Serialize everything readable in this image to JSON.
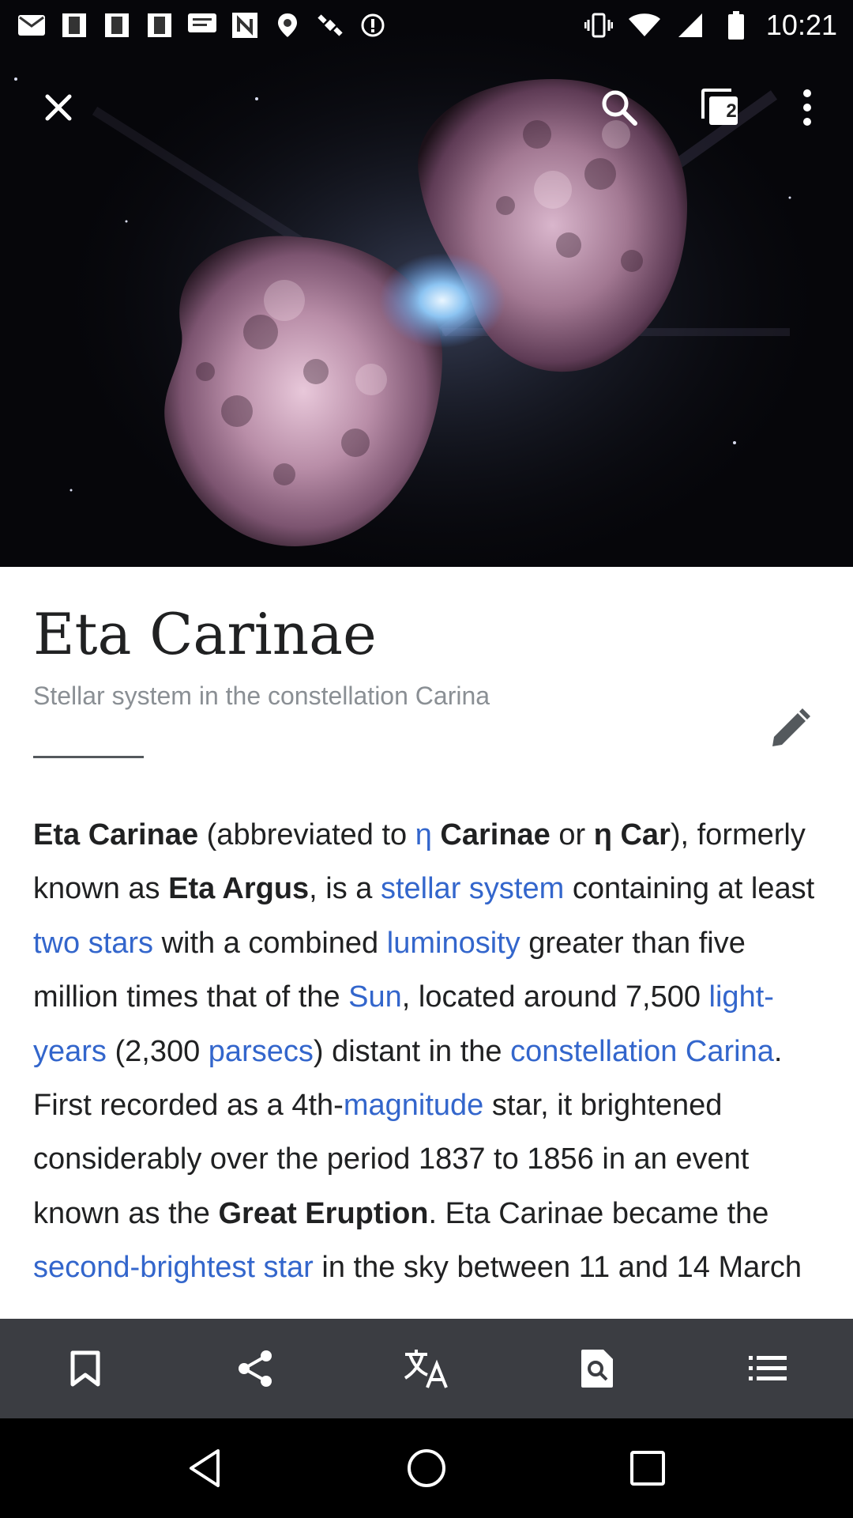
{
  "status_bar": {
    "time": "10:21",
    "left_icons": [
      "mail-icon",
      "photo-icon",
      "photo-icon",
      "photo-icon",
      "message-icon",
      "news-icon",
      "fake-gps-icon",
      "satellite-icon",
      "alert-icon"
    ],
    "right_icons": [
      "vibrate-icon",
      "wifi-icon",
      "signal-icon",
      "battery-icon"
    ]
  },
  "header": {
    "tabs_count": "2",
    "icons": [
      "close-icon",
      "search-icon",
      "tabs-icon",
      "overflow-menu-icon"
    ]
  },
  "article": {
    "title": "Eta Carinae",
    "description": "Stellar system in the constellation Carina",
    "p": {
      "t1": "Eta Carinae",
      "t2": " (abbreviated to ",
      "t3": "η",
      "t4": " Carinae",
      "t5": " or ",
      "t6": "η Car",
      "t7": "), formerly known as ",
      "t8": "Eta Argus",
      "t9": ", is a ",
      "t10": "stellar system",
      "t11": " containing at least ",
      "t12": "two stars",
      "t13": " with a combined ",
      "t14": "luminosity",
      "t15": " greater than five million times that of the ",
      "t16": "Sun",
      "t17": ", located around 7,500 ",
      "t18": "light-years",
      "t19": " (2,300 ",
      "t20": "parsecs",
      "t21": ") distant in the ",
      "t22": "constellation Carina",
      "t23": ". First recorded as a 4th-",
      "t24": "magnitude",
      "t25": " star, it brightened considerably over the period 1837 to 1856 in an event known as the ",
      "t26": "Great Eruption",
      "t27": ". Eta Carinae became the ",
      "t28": "second-brightest star",
      "t29": " in the sky between 11 and 14 March"
    }
  },
  "toolbar": {
    "items": [
      "bookmark-icon",
      "share-icon",
      "translate-icon",
      "find-in-page-icon",
      "contents-icon"
    ]
  },
  "colors": {
    "link": "#3366cc",
    "text": "#202122",
    "toolbar_bg": "#3b3d42",
    "nav_bg": "#000000"
  }
}
